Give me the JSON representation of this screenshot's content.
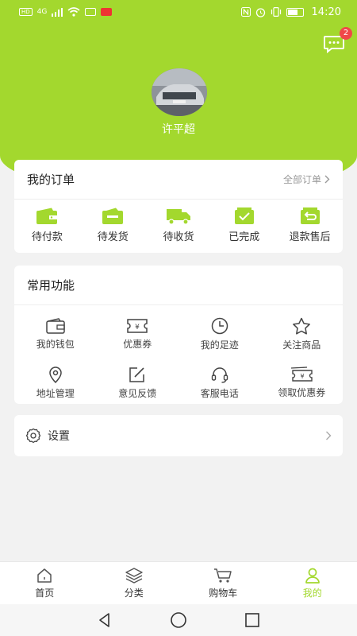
{
  "status_bar": {
    "time": "14:20",
    "net_tag": "HD",
    "net_speed": "4G"
  },
  "header": {
    "message_badge": "2",
    "username": "许平超"
  },
  "orders": {
    "title": "我的订单",
    "all_label": "全部订单",
    "items": [
      {
        "label": "待付款",
        "icon": "wallet-icon"
      },
      {
        "label": "待发货",
        "icon": "wallet-box-icon"
      },
      {
        "label": "待收货",
        "icon": "truck-icon"
      },
      {
        "label": "已完成",
        "icon": "check-box-icon"
      },
      {
        "label": "退款售后",
        "icon": "refund-icon"
      }
    ]
  },
  "functions": {
    "title": "常用功能",
    "items": [
      {
        "label": "我的钱包",
        "icon": "wallet-icon"
      },
      {
        "label": "优惠券",
        "icon": "coupon-icon"
      },
      {
        "label": "我的足迹",
        "icon": "clock-icon"
      },
      {
        "label": "关注商品",
        "icon": "star-icon"
      },
      {
        "label": "地址管理",
        "icon": "location-icon"
      },
      {
        "label": "意见反馈",
        "icon": "edit-icon"
      },
      {
        "label": "客服电话",
        "icon": "headset-icon"
      },
      {
        "label": "领取优惠券",
        "icon": "coupon-get-icon"
      }
    ]
  },
  "settings": {
    "label": "设置"
  },
  "tabbar": {
    "active_color": "#a3d82e",
    "items": [
      {
        "label": "首页",
        "icon": "home-icon"
      },
      {
        "label": "分类",
        "icon": "layers-icon"
      },
      {
        "label": "购物车",
        "icon": "cart-icon"
      },
      {
        "label": "我的",
        "icon": "user-icon",
        "active": true
      }
    ]
  },
  "theme": {
    "accent": "#a3d82e"
  }
}
